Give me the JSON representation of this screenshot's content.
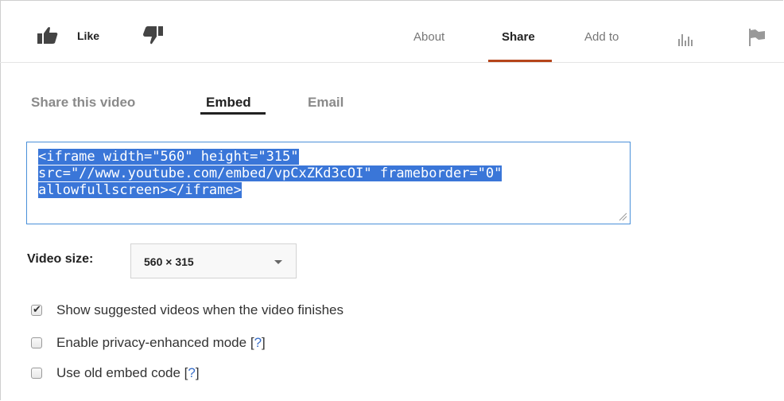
{
  "header": {
    "like_label": "Like",
    "tabs": [
      "About",
      "Share",
      "Add to"
    ],
    "active_tab": "Share"
  },
  "share": {
    "subtabs": [
      "Share this video",
      "Embed",
      "Email"
    ],
    "active_subtab": "Embed",
    "embed_code_lines": [
      "<iframe width=\"560\" height=\"315\"",
      "src=\"//www.youtube.com/embed/vpCxZKd3cOI\" frameborder=\"0\"",
      "allowfullscreen></iframe>"
    ],
    "video_size_label": "Video size:",
    "video_size_value": "560 × 315",
    "options": [
      {
        "label": "Show suggested videos when the video finishes",
        "checked": true,
        "help": ""
      },
      {
        "label": "Enable privacy-enhanced mode",
        "checked": false,
        "help": "?"
      },
      {
        "label": "Use old embed code",
        "checked": false,
        "help": "?"
      }
    ]
  },
  "colors": {
    "active_tab_underline": "#b5451b",
    "selection": "#3a76d8",
    "link": "#3a6fc9"
  }
}
